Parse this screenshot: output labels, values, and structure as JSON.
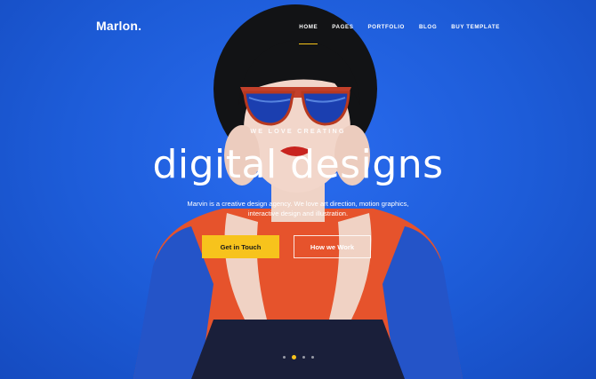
{
  "brand": {
    "name": "Marlon."
  },
  "nav": {
    "items": [
      {
        "label": "HOME",
        "active": true
      },
      {
        "label": "PAGES",
        "active": false
      },
      {
        "label": "PORTFOLIO",
        "active": false
      },
      {
        "label": "BLOG",
        "active": false
      },
      {
        "label": "BUY TEMPLATE",
        "active": false
      }
    ]
  },
  "hero": {
    "eyebrow": "WE LOVE CREATING",
    "headline": "digital designs",
    "description": "Marvin is a creative design agency. We love art direction, motion graphics, interactive design and illustration.",
    "primary_button": "Get in Touch",
    "secondary_button": "How we Work"
  },
  "slider": {
    "slide_count": 4,
    "active_slide": 2
  },
  "colors": {
    "background": "#1f5fd6",
    "accent": "#f7c31c",
    "sweater_orange": "#e8542a",
    "hair": "#121315"
  }
}
